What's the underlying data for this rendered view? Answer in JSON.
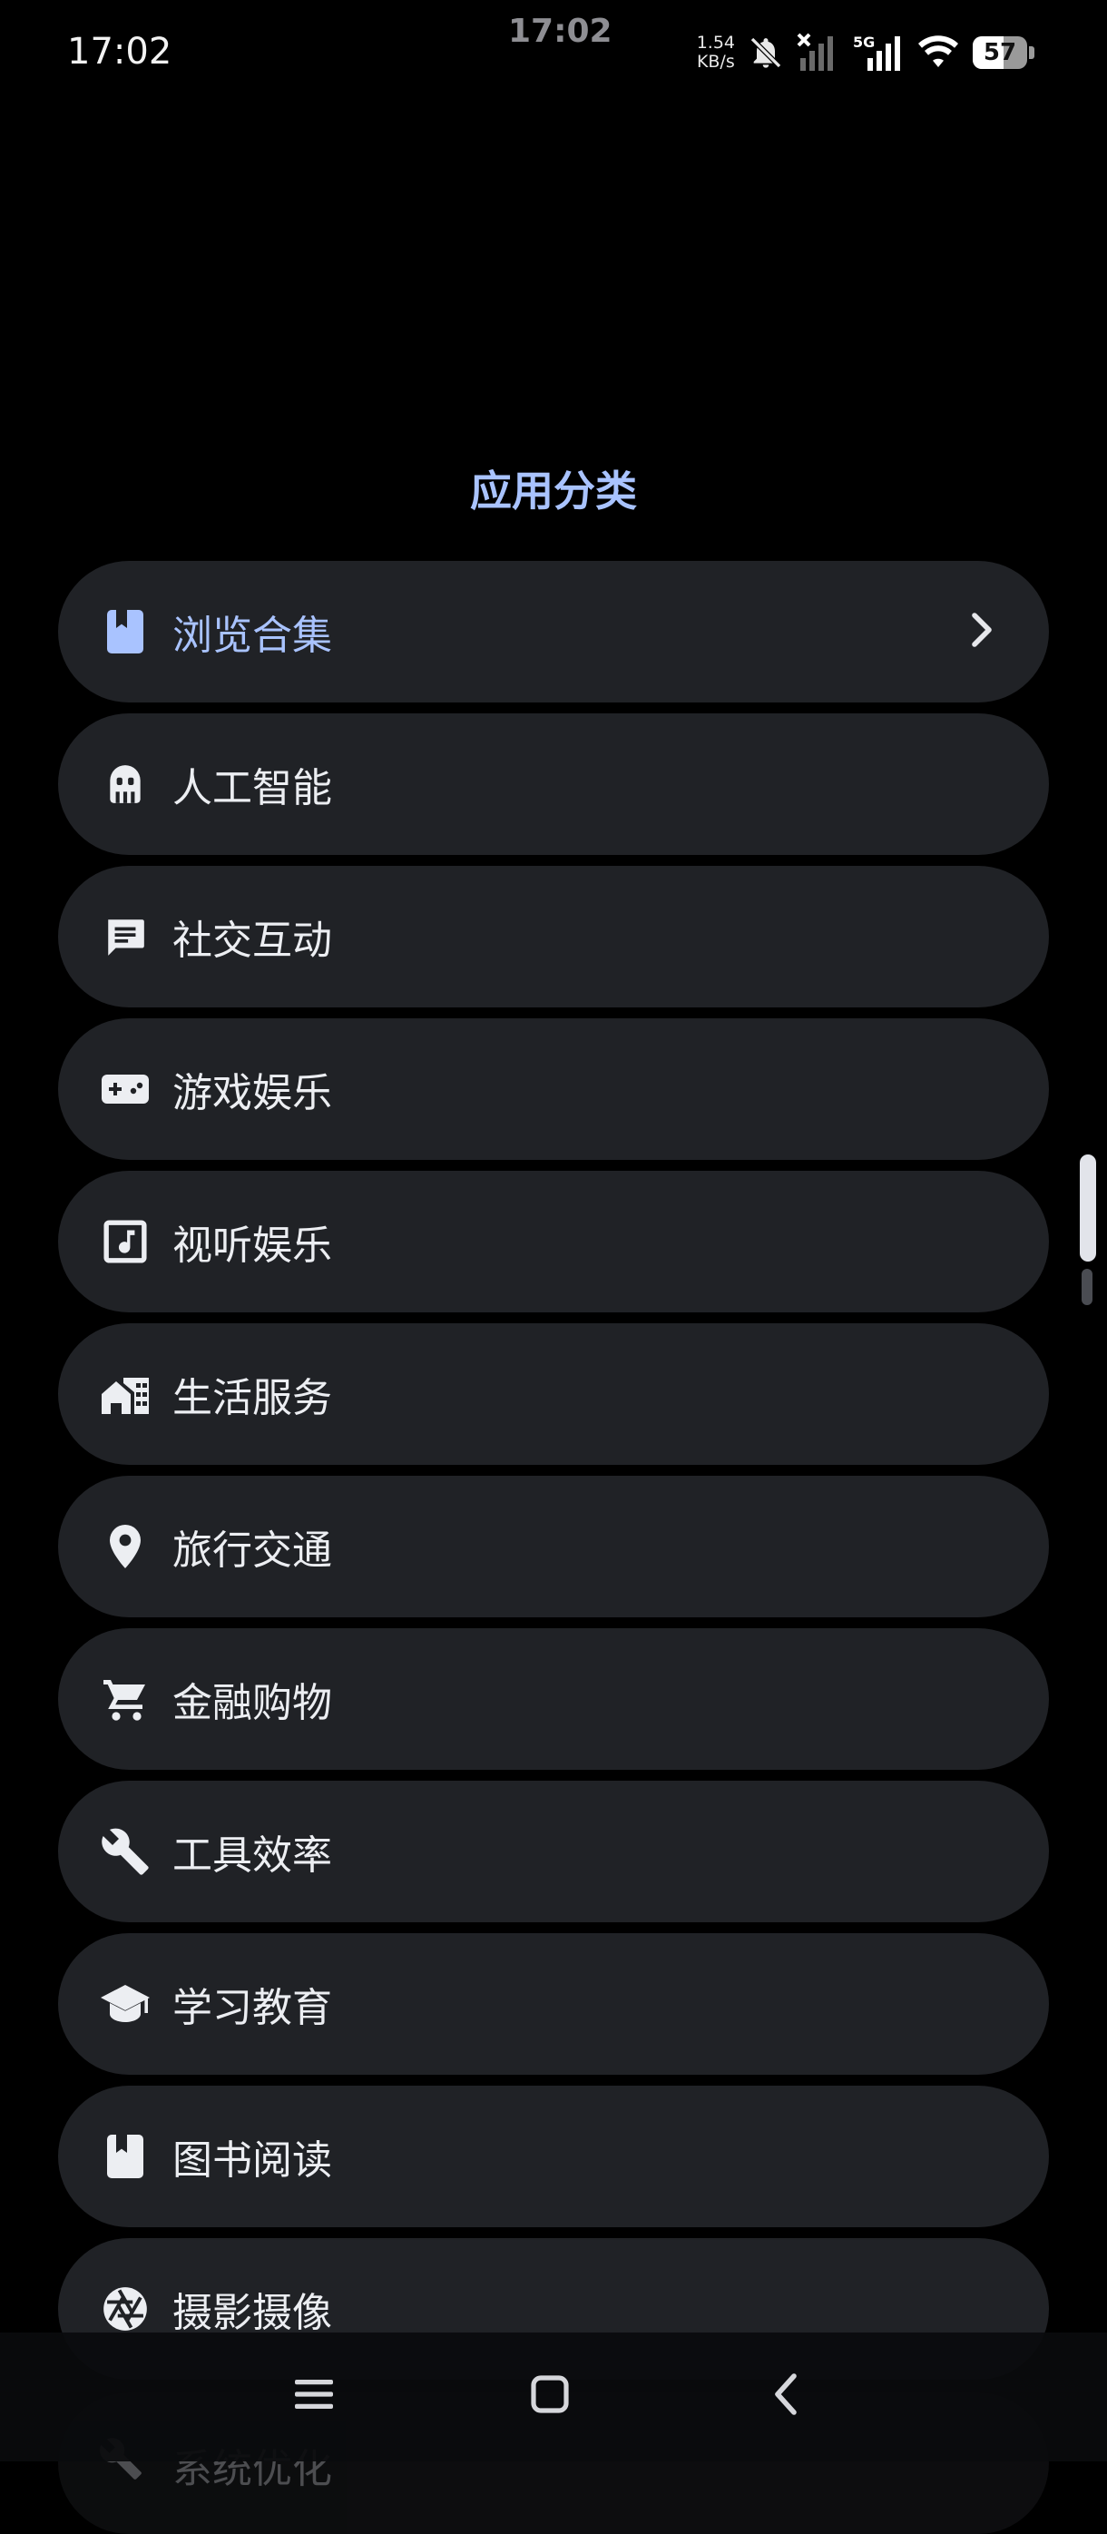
{
  "status_bar": {
    "time_left": "17:02",
    "time_center": "17:02",
    "net_speed_value": "1.54",
    "net_speed_unit": "KB/s",
    "network_type": "5G",
    "battery_level": "57",
    "battery_fraction": 0.57
  },
  "page": {
    "title": "应用分类"
  },
  "categories": [
    {
      "label": "浏览合集",
      "icon": "bookmark-book-icon",
      "selected": true
    },
    {
      "label": "人工智能",
      "icon": "robot-icon",
      "selected": false
    },
    {
      "label": "社交互动",
      "icon": "chat-bubble-icon",
      "selected": false
    },
    {
      "label": "游戏娱乐",
      "icon": "gamepad-icon",
      "selected": false
    },
    {
      "label": "视听娱乐",
      "icon": "music-note-icon",
      "selected": false
    },
    {
      "label": "生活服务",
      "icon": "home-work-icon",
      "selected": false
    },
    {
      "label": "旅行交通",
      "icon": "location-pin-icon",
      "selected": false
    },
    {
      "label": "金融购物",
      "icon": "shopping-cart-icon",
      "selected": false
    },
    {
      "label": "工具效率",
      "icon": "wrench-icon",
      "selected": false
    },
    {
      "label": "学习教育",
      "icon": "graduation-cap-icon",
      "selected": false
    },
    {
      "label": "图书阅读",
      "icon": "book-icon",
      "selected": false
    },
    {
      "label": "摄影摄像",
      "icon": "camera-aperture-icon",
      "selected": false
    },
    {
      "label": "系统优化",
      "icon": "wrench-icon",
      "selected": false
    }
  ],
  "colors": {
    "accent": "#a9c3ff",
    "item_background": "#202226",
    "background": "#000000"
  },
  "nav": {
    "menu_icon": "menu-icon",
    "home_icon": "home-square-icon",
    "back_icon": "back-chevron-icon"
  }
}
